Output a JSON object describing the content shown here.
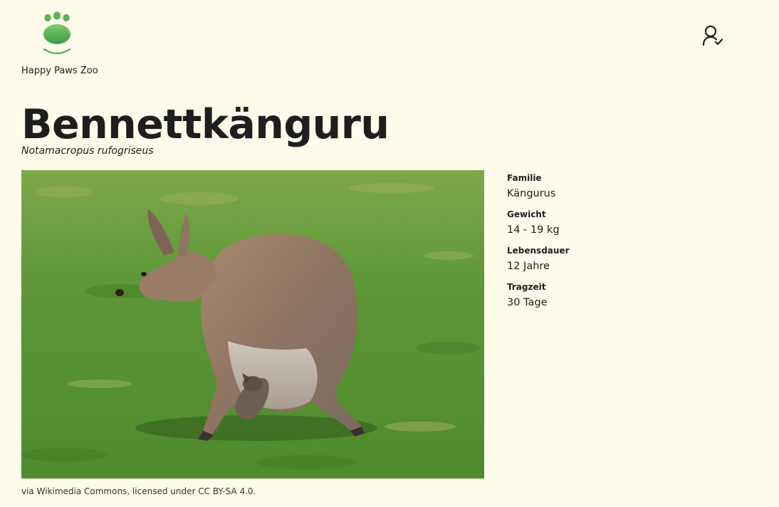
{
  "site": {
    "name": "Happy Paws Zoo",
    "logo_color": "#4caf50"
  },
  "header": {
    "user_icon": "user-check-icon"
  },
  "animal": {
    "name": "Bennettkänguru",
    "scientific_name": "Notamacropus rufogriseus",
    "image_subject": "kangaroo with joey in pouch on grass",
    "credit": "via Wikimedia Commons, licensed under CC BY-SA 4.0."
  },
  "facts": [
    {
      "label": "Familie",
      "value": "Kängurus"
    },
    {
      "label": "Gewicht",
      "value": "14 - 19 kg"
    },
    {
      "label": "Lebensdauer",
      "value": "12 Jahre"
    },
    {
      "label": "Tragzeit",
      "value": "30 Tage"
    }
  ]
}
